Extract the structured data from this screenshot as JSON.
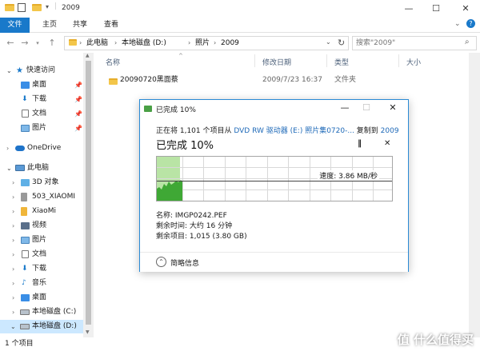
{
  "window": {
    "title": "2009"
  },
  "ribbon": {
    "tabs": [
      "文件",
      "主页",
      "共享",
      "查看"
    ]
  },
  "address": {
    "crumbs": [
      "此电脑",
      "本地磁盘 (D:)",
      "照片",
      "2009"
    ],
    "search_placeholder": "搜索\"2009\""
  },
  "nav": {
    "items": [
      {
        "label": "快速访问"
      },
      {
        "label": "桌面"
      },
      {
        "label": "下载"
      },
      {
        "label": "文档"
      },
      {
        "label": "图片"
      },
      {
        "label": "OneDrive"
      },
      {
        "label": "此电脑"
      },
      {
        "label": "3D 对象"
      },
      {
        "label": "503_XIAOMI"
      },
      {
        "label": "XiaoMi"
      },
      {
        "label": "视频"
      },
      {
        "label": "图片"
      },
      {
        "label": "文档"
      },
      {
        "label": "下载"
      },
      {
        "label": "音乐"
      },
      {
        "label": "桌面"
      },
      {
        "label": "本地磁盘 (C:)"
      },
      {
        "label": "本地磁盘 (D:)"
      }
    ]
  },
  "filelist": {
    "columns": [
      "名称",
      "修改日期",
      "类型",
      "大小"
    ],
    "rows": [
      {
        "name": "20090720黑面蔡",
        "date": "2009/7/23 16:37",
        "type": "文件夹",
        "size": ""
      }
    ]
  },
  "statusbar": {
    "count": "1 个项目"
  },
  "dialog": {
    "title": "已完成 10%",
    "line_prefix": "正在将 1,101 个项目从 ",
    "source": "DVD RW 驱动器 (E:) 照片集0720-...",
    "line_mid": " 复制到 ",
    "dest": "2009",
    "percent_text": "已完成 10%",
    "progress": 0.1,
    "speed": "速度: 3.86 MB/秒",
    "name": "名称: IMGP0242.PEF",
    "time_left": "剩余时间: 大约 16 分钟",
    "items_left": "剩余项目: 1,015 (3.80 GB)",
    "fewer_details": "简略信息"
  },
  "watermark": "值 什么值得买",
  "colors": {
    "accent": "#1979ca",
    "progress_fill": "#b9e4a5",
    "graph_green": "#3fa835",
    "selected": "#cce8ff"
  }
}
